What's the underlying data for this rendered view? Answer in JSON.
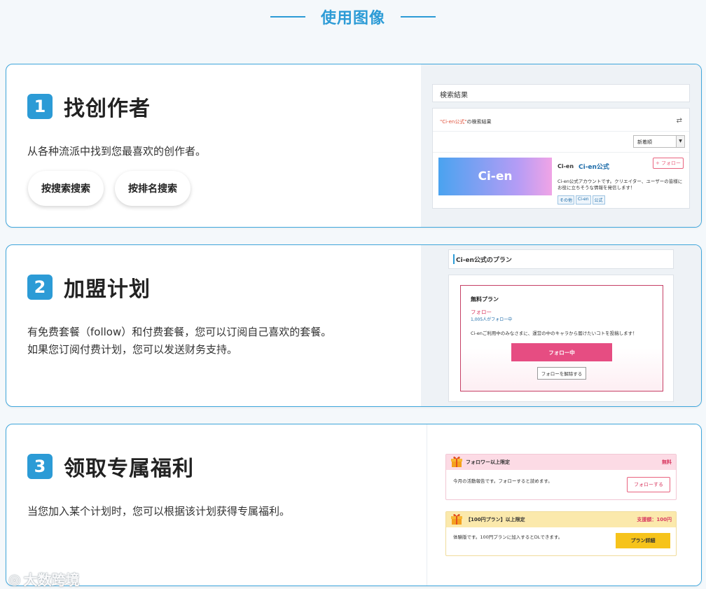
{
  "heading": {
    "title": "使用图像"
  },
  "sections": [
    {
      "number": "1",
      "title": "找创作者",
      "desc_lines": [
        "从各种流派中找到您最喜欢的创作者。"
      ],
      "buttons": [
        "按搜索搜索",
        "按排名搜索"
      ],
      "mock": {
        "bar_title": "検索結果",
        "query_term": "\"Ci-en公式\"",
        "query_suffix": "の検索結果",
        "sort_value": "新着順",
        "banner_text": "Ci-en",
        "logo_text": "Ci-en",
        "creator_name": "Ci-en公式",
        "follow_label": "+ フォロー",
        "description": "Ci-en公式アカウントです。クリエイター、ユーザーの皆様にお役に立ちそうな情報を発信します！",
        "tags": [
          "その他",
          "Ci-en",
          "公式"
        ]
      }
    },
    {
      "number": "2",
      "title": "加盟计划",
      "desc_lines": [
        "有免费套餐（follow）和付费套餐，您可以订阅自己喜欢的套餐。",
        "如果您订阅付费计划，您可以发送财务支持。"
      ],
      "mock": {
        "bar_title": "Ci-en公式のプラン",
        "plan_title": "無料プラン",
        "follow_text": "フォロー",
        "follower_count": "1,005人がフォロー中",
        "message": "Ci-enご利用中のみなさまに、運営の中のキャラから届けたいコトを投稿します！",
        "following_button": "フォロー中",
        "unfollow_button": "フォローを解除する"
      }
    },
    {
      "number": "3",
      "title": "领取专属福利",
      "desc_lines": [
        "当您加入某个计划时，您可以根据该计划获得专属福利。"
      ],
      "mock": {
        "box1": {
          "label": "フォロワー以上限定",
          "right": "無料",
          "text": "今月の活動報告です。フォローすると読めます。",
          "button": "フォローする"
        },
        "box2": {
          "label": "【100円プラン】以上限定",
          "right": "支援額：100円",
          "text": "体験版です。100円プランに加入するとDLできます。",
          "button": "プラン詳細"
        }
      }
    }
  ],
  "watermark": {
    "text": "大数跨境"
  },
  "colors": {
    "accent": "#2c9bd6",
    "pink": "#e64d82",
    "yellow": "#f6c31b"
  }
}
